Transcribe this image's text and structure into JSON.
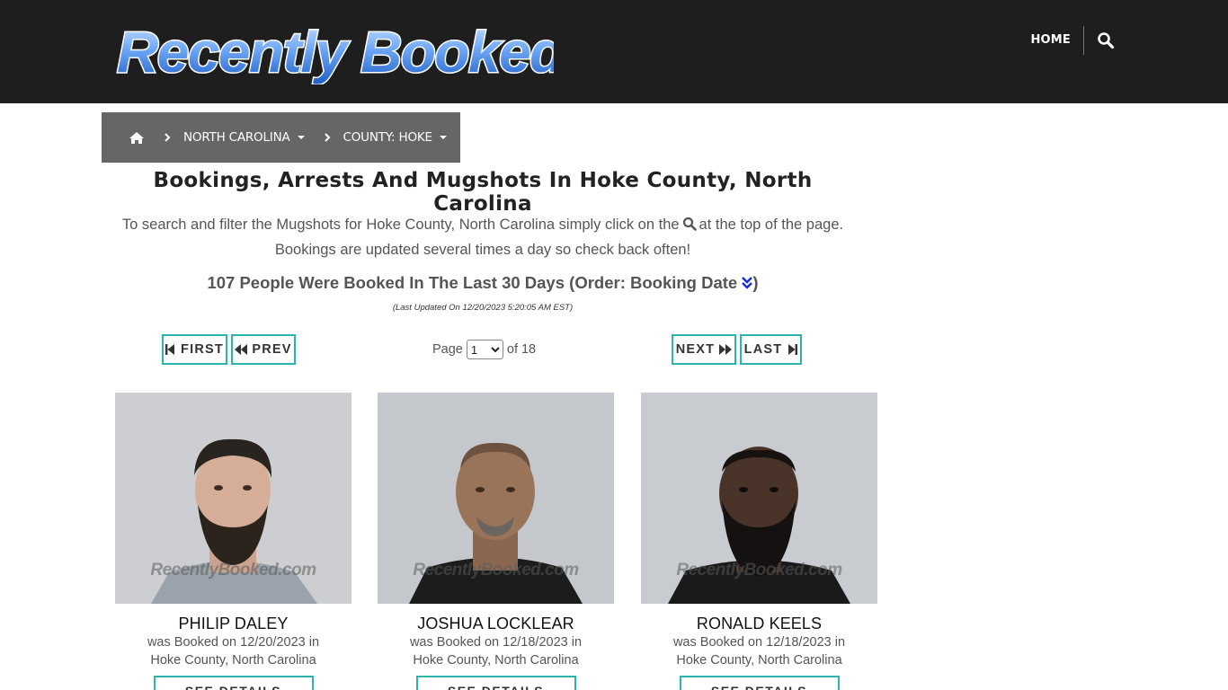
{
  "header": {
    "logo_text": "Recently Booked",
    "nav_home": "HOME",
    "search_icon": "search-icon"
  },
  "breadcrumb": {
    "home_icon": "home-icon",
    "state": "NORTH CAROLINA",
    "county": "COUNTY: HOKE"
  },
  "page": {
    "title": "Bookings, Arrests And Mugshots In Hoke County, North Carolina",
    "intro_before": "To search and filter the Mugshots for Hoke County, North Carolina simply click on the",
    "intro_after": "at the top of the page.",
    "intro_line2": "Bookings are updated several times a day so check back often!",
    "count_text": "107 People Were Booked In The Last 30 Days (Order: Booking Date",
    "count_close": ")",
    "updated": "(Last Updated On 12/20/2023 5:20:05 AM EST)"
  },
  "pager": {
    "first": "FIRST",
    "prev": "PREV",
    "next": "NEXT",
    "last": "LAST",
    "page_label": "Page",
    "current_page": "1",
    "of_label": "of 18"
  },
  "cards": [
    {
      "name": "PHILIP DALEY",
      "booked_line1": "was Booked on 12/20/2023 in",
      "booked_line2": "Hoke County, North Carolina",
      "watermark": "RecentlyBooked.com",
      "button": "SEE DETAILS"
    },
    {
      "name": "JOSHUA LOCKLEAR",
      "booked_line1": "was Booked on 12/18/2023 in",
      "booked_line2": "Hoke County, North Carolina",
      "watermark": "RecentlyBooked.com",
      "button": "SEE DETAILS"
    },
    {
      "name": "RONALD KEELS",
      "booked_line1": "was Booked on 12/18/2023 in",
      "booked_line2": "Hoke County, North Carolina",
      "watermark": "RecentlyBooked.com",
      "button": "SEE DETAILS"
    }
  ],
  "colors": {
    "header_bg": "#1e1e1e",
    "breadcrumb_bg": "#666666",
    "button_border": "#2bb5ac",
    "logo_blue": "#3a7fe0"
  }
}
